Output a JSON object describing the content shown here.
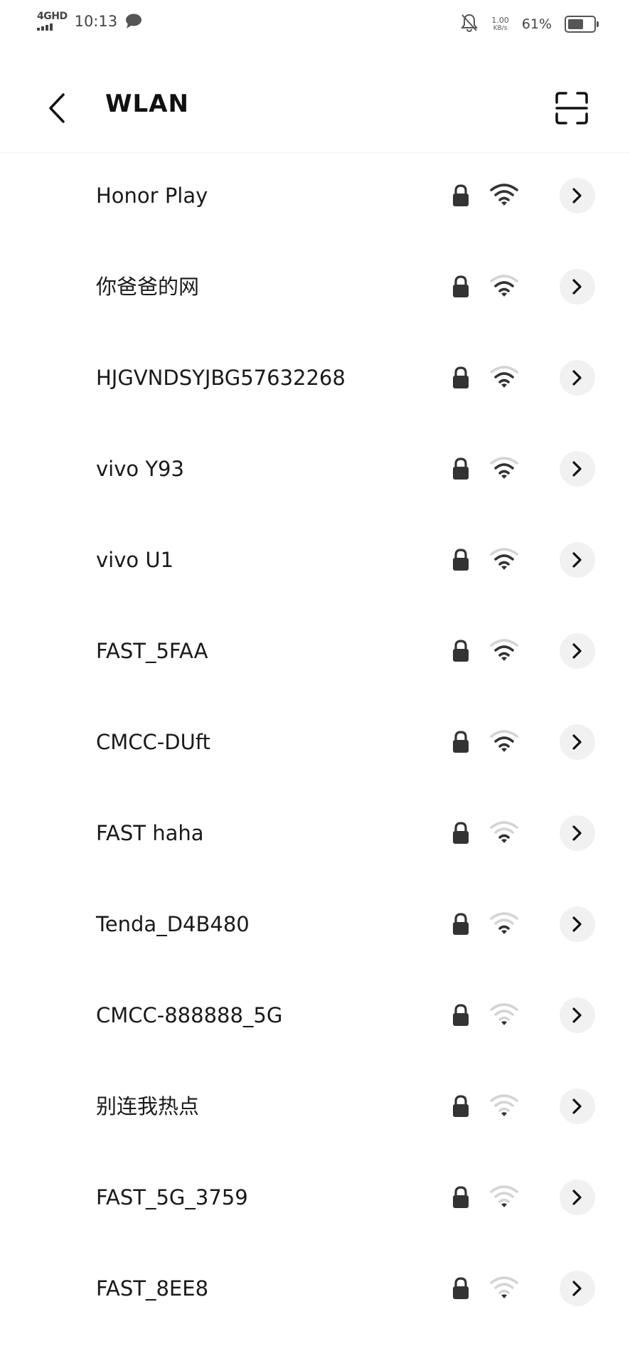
{
  "status_bar": {
    "network_type": "4GHD",
    "time": "10:13",
    "speed_value": "1.00",
    "speed_unit": "KB/s",
    "battery_percent": "61%",
    "battery_level": 0.61
  },
  "header": {
    "title": "WLAN"
  },
  "networks": [
    {
      "name": "Honor Play",
      "secured": true,
      "signal": 4
    },
    {
      "name": "你爸爸的网",
      "secured": true,
      "signal": 3
    },
    {
      "name": "HJGVNDSYJBG57632268",
      "secured": true,
      "signal": 3
    },
    {
      "name": "vivo Y93",
      "secured": true,
      "signal": 3
    },
    {
      "name": "vivo U1",
      "secured": true,
      "signal": 3
    },
    {
      "name": "FAST_5FAA",
      "secured": true,
      "signal": 3
    },
    {
      "name": "CMCC-DUft",
      "secured": true,
      "signal": 3
    },
    {
      "name": "FAST haha",
      "secured": true,
      "signal": 2
    },
    {
      "name": "Tenda_D4B480",
      "secured": true,
      "signal": 2
    },
    {
      "name": "CMCC-888888_5G",
      "secured": true,
      "signal": 1
    },
    {
      "name": "别连我热点",
      "secured": true,
      "signal": 1
    },
    {
      "name": "FAST_5G_3759",
      "secured": true,
      "signal": 1
    },
    {
      "name": "FAST_8EE8",
      "secured": true,
      "signal": 1
    }
  ],
  "colors": {
    "signal_on": "#333333",
    "signal_off": "#d4d4d4",
    "detail_bg": "#f1f1f1"
  }
}
